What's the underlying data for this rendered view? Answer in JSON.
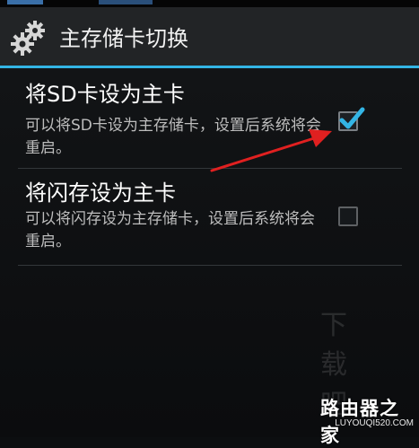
{
  "action_bar": {
    "title": "主存储卡切换",
    "icon": "gears-icon",
    "underline_color": "#33b5e5"
  },
  "preferences": [
    {
      "title": "将SD卡设为主卡",
      "summary": "可以将SD卡设为主存储卡，设置后系统将会重启。",
      "checked": true
    },
    {
      "title": "将闪存设为主卡",
      "summary": "可以将闪存设为主存储卡，设置后系统将会重启。",
      "checked": false
    }
  ],
  "annotation": {
    "icon": "red-arrow-icon",
    "color": "#e02020"
  },
  "watermark": {
    "big": "路由器之家",
    "small": "LUYOUQI520.COM",
    "background_mark": "下载吧"
  }
}
